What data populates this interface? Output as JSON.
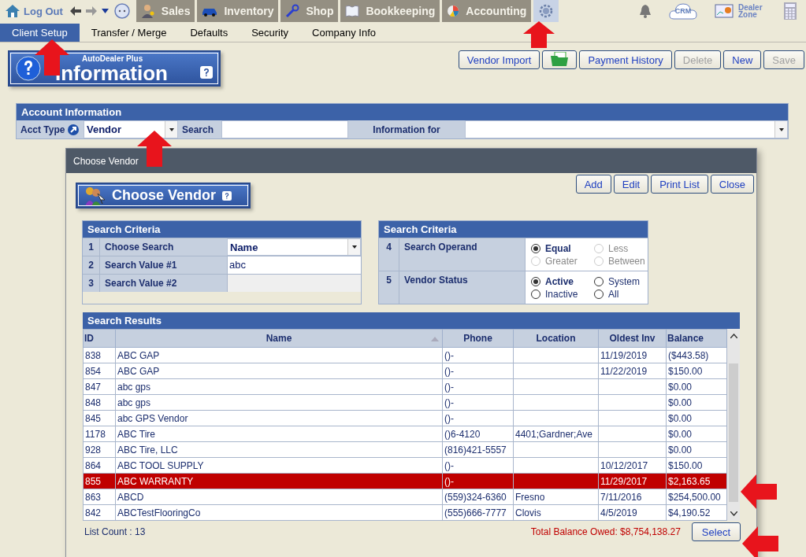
{
  "top_nav": {
    "logout": "Log Out",
    "modules": [
      {
        "kind": "sales",
        "label": "Sales",
        "selected": false
      },
      {
        "kind": "inventory",
        "label": "Inventory",
        "selected": false
      },
      {
        "kind": "shop",
        "label": "Shop",
        "selected": false
      },
      {
        "kind": "bookkeeping",
        "label": "Bookkeeping",
        "selected": false
      },
      {
        "kind": "accounting",
        "label": "Accounting",
        "selected": false
      },
      {
        "kind": "settings",
        "selected": true
      }
    ],
    "crm": "CRM",
    "dealer_zone": "Dealer Zone"
  },
  "sub_tabs": [
    {
      "label": "Client Setup",
      "selected": true
    },
    {
      "label": "Transfer / Merge",
      "selected": false
    },
    {
      "label": "Defaults",
      "selected": false
    },
    {
      "label": "Security",
      "selected": false
    },
    {
      "label": "Company Info",
      "selected": false
    }
  ],
  "banner": {
    "subtitle": "AutoDealer Plus",
    "title": "Information"
  },
  "toolbar": [
    {
      "kind": "text",
      "label": "Vendor Import",
      "disabled": false
    },
    {
      "kind": "folder"
    },
    {
      "kind": "text",
      "label": "Payment History",
      "disabled": false
    },
    {
      "kind": "text",
      "label": "Delete",
      "disabled": true
    },
    {
      "kind": "text",
      "label": "New",
      "disabled": false
    },
    {
      "kind": "text",
      "label": "Save",
      "disabled": true
    }
  ],
  "account_info": {
    "title": "Account Information",
    "acct_type_label": "Acct Type",
    "acct_type": "Vendor",
    "search_label": "Search",
    "information_for_label": "Information for"
  },
  "dialog": {
    "title": "Choose Vendor",
    "buttons": [
      "Add",
      "Edit",
      "Print List",
      "Close"
    ],
    "banner": "Choose Vendor",
    "criteria_left": {
      "title": "Search Criteria",
      "rows": [
        {
          "num": "1",
          "label": "Choose Search",
          "value": "Name",
          "kind": "dropdown"
        },
        {
          "num": "2",
          "label": "Search Value #1",
          "value": "abc",
          "kind": "input"
        },
        {
          "num": "3",
          "label": "Search Value #2",
          "value": "",
          "kind": "disabled"
        }
      ]
    },
    "criteria_right": {
      "title": "Search Criteria",
      "rows": [
        {
          "num": "4",
          "label": "Search Operand",
          "options": [
            {
              "label": "Equal",
              "selected": true,
              "disabled": false
            },
            {
              "label": "Less",
              "selected": false,
              "disabled": true
            },
            {
              "label": "Greater",
              "selected": false,
              "disabled": true
            },
            {
              "label": "Between",
              "selected": false,
              "disabled": true
            }
          ]
        },
        {
          "num": "5",
          "label": "Vendor Status",
          "options": [
            {
              "label": "Active",
              "selected": true,
              "disabled": false
            },
            {
              "label": "System",
              "selected": false,
              "disabled": false
            },
            {
              "label": "Inactive",
              "selected": false,
              "disabled": false
            },
            {
              "label": "All",
              "selected": false,
              "disabled": false
            }
          ]
        }
      ]
    },
    "results": {
      "title": "Search Results",
      "columns": [
        {
          "label": "ID",
          "sorted": false
        },
        {
          "label": "Name",
          "sorted": true
        },
        {
          "label": "Phone",
          "sorted": false
        },
        {
          "label": "Location",
          "sorted": false
        },
        {
          "label": "Oldest Inv",
          "sorted": false
        },
        {
          "label": "Balance",
          "sorted": false
        }
      ],
      "rows": [
        {
          "cells": [
            "838",
            "ABC GAP",
            "()-",
            "",
            "11/19/2019",
            "($443.58)"
          ],
          "selected": false
        },
        {
          "cells": [
            "854",
            "ABC GAP",
            "()-",
            "",
            "11/22/2019",
            "$150.00"
          ],
          "selected": false
        },
        {
          "cells": [
            "847",
            "abc gps",
            "()-",
            "",
            "",
            "$0.00"
          ],
          "selected": false
        },
        {
          "cells": [
            "848",
            "abc gps",
            "()-",
            "",
            "",
            "$0.00"
          ],
          "selected": false
        },
        {
          "cells": [
            "845",
            "abc GPS Vendor",
            "()-",
            "",
            "",
            "$0.00"
          ],
          "selected": false
        },
        {
          "cells": [
            "1178",
            "ABC Tire",
            "()6-4120",
            "4401;Gardner;Ave",
            "",
            "$0.00"
          ],
          "selected": false
        },
        {
          "cells": [
            "928",
            "ABC Tire, LLC",
            "(816)421-5557",
            "",
            "",
            "$0.00"
          ],
          "selected": false
        },
        {
          "cells": [
            "864",
            "ABC TOOL SUPPLY",
            "()-",
            "",
            "10/12/2017",
            "$150.00"
          ],
          "selected": false
        },
        {
          "cells": [
            "855",
            "ABC WARRANTY",
            "()-",
            "",
            "11/29/2017",
            "$2,163.65"
          ],
          "selected": true
        },
        {
          "cells": [
            "863",
            "ABCD",
            "(559)324-6360",
            "Fresno",
            "7/11/2016",
            "$254,500.00"
          ],
          "selected": false
        },
        {
          "cells": [
            "842",
            "ABCTestFlooringCo",
            "(555)666-7777",
            "Clovis",
            "4/5/2019",
            "$4,190.52"
          ],
          "selected": false
        }
      ]
    },
    "list_count": "List Count : 13",
    "total": "Total Balance Owed: $8,754,138.27",
    "select_button": "Select"
  }
}
